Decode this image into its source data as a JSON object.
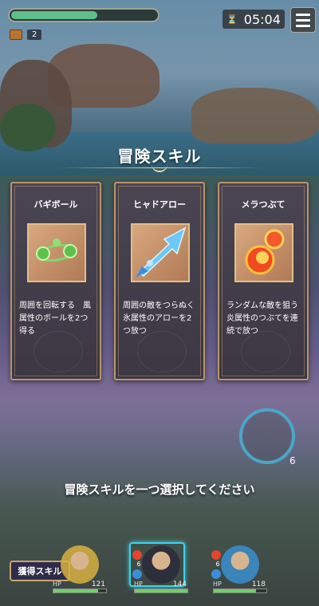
{
  "hud": {
    "progress": 0.6,
    "chest_count": "2",
    "timer": "05:04",
    "hourglass_symbol": "⏳"
  },
  "title": "冒険スキル",
  "cards": [
    {
      "name": "バギボール",
      "desc": "周囲を回転する　風属性のボールを2つ得る",
      "icon": "wind-balls-icon"
    },
    {
      "name": "ヒャドアロー",
      "desc": "周囲の敵をつらぬく氷属性のアローを2つ放つ",
      "icon": "ice-arrow-icon"
    },
    {
      "name": "メラつぶて",
      "desc": "ランダムな敵を狙う炎属性のつぶてを連続で放つ",
      "icon": "fire-pebbles-icon"
    }
  ],
  "prompt": "冒険スキルを一つ選択してください",
  "ring_count": "6",
  "acquired_button": "獲得スキル",
  "party": [
    {
      "hp_label": "HP",
      "hp_value": "121",
      "hp_fraction": 0.85
    },
    {
      "hp_label": "HP",
      "hp_value": "144",
      "hp_fraction": 1.0,
      "level": "6"
    },
    {
      "hp_label": "HP",
      "hp_value": "118",
      "hp_fraction": 0.8,
      "level": "6"
    }
  ],
  "colors": {
    "accent": "#3bd2e6",
    "card_border": "#b8946a",
    "hp": "#6fcf6a"
  }
}
